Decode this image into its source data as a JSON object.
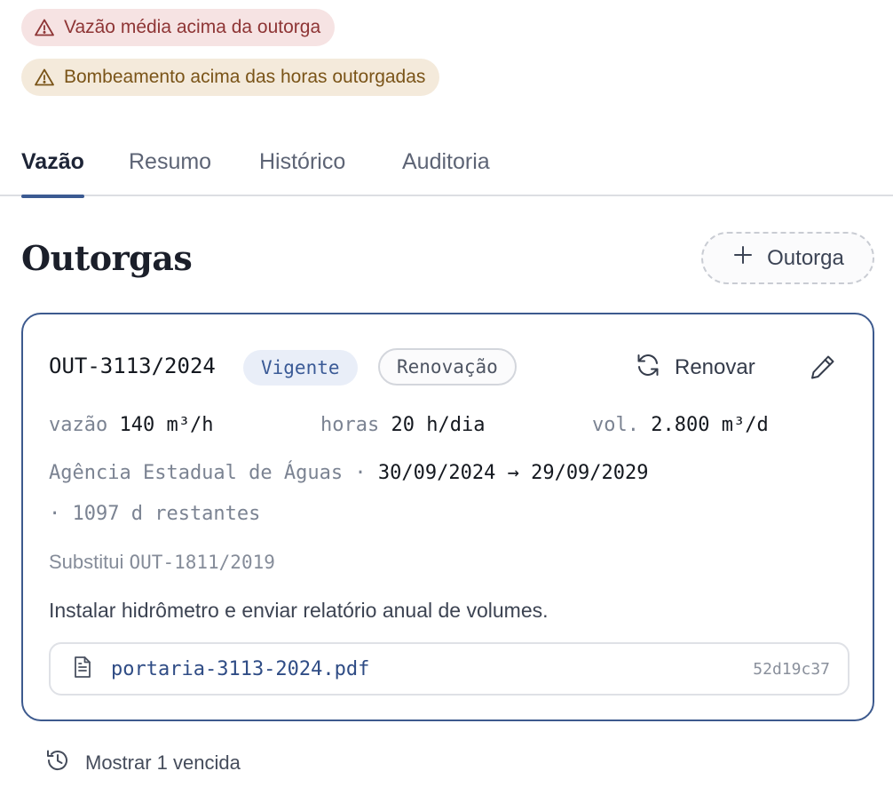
{
  "alerts": [
    {
      "text": "Vazão média acima da outorga",
      "color": "#8e3535",
      "icon": "warning-triangle-icon"
    },
    {
      "text": "Bombeamento acima das horas outorgadas",
      "color": "#7a5418",
      "icon": "warning-triangle-icon"
    }
  ],
  "tabs": [
    {
      "label": "Vazão",
      "active": true
    },
    {
      "label": "Resumo",
      "active": false
    },
    {
      "label": "Histórico",
      "active": false
    },
    {
      "label": "Auditoria",
      "active": false
    }
  ],
  "section": {
    "title": "Outorgas",
    "add_button_label": "Outorga"
  },
  "grant": {
    "id": "OUT-3113/2024",
    "status": "Vigente",
    "tag": "Renovação",
    "renew_label": "Renovar",
    "metrics": [
      {
        "label": "vazão",
        "value": "140 m³/h"
      },
      {
        "label": "horas",
        "value": "20 h/dia"
      },
      {
        "label": "vol.",
        "value": "2.800 m³/d"
      }
    ],
    "agency": "Agência Estadual de Águas",
    "dates": "30/09/2024 → 29/09/2029",
    "remaining": "· 1097 d restantes",
    "substitutes_label": "Substitui",
    "substitutes_id": "OUT-1811/2019",
    "condition": "Instalar hidrômetro e enviar relatório anual de volumes.",
    "file": {
      "name": "portaria-3113-2024.pdf",
      "hash": "52d19c37",
      "icon": "document-icon"
    }
  },
  "footer": {
    "show_expired_label": "Mostrar 1 vencida",
    "icon": "history-icon"
  },
  "colors": {
    "accent": "#3d5a8e",
    "alert_red_bg": "#f6e3e3",
    "alert_amber_bg": "#f4eadb",
    "status_badge_bg": "#e9eef8"
  }
}
